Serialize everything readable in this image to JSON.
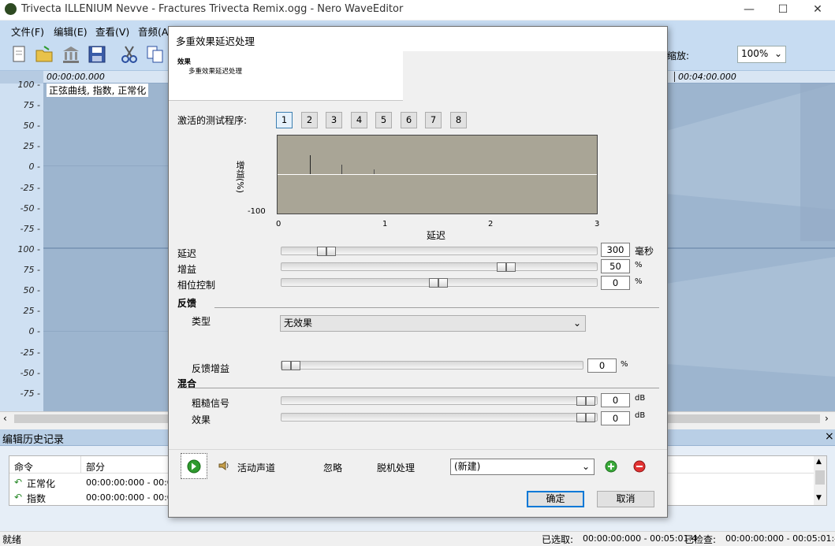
{
  "window": {
    "title": "Trivecta ILLENIUM Nevve - Fractures Trivecta Remix.ogg - Nero WaveEditor",
    "minimize_glyph": "—",
    "maximize_glyph": "☐",
    "close_glyph": "✕"
  },
  "menu": [
    "文件(F)",
    "编辑(E)",
    "查看(V)",
    "音频(A)"
  ],
  "toolbar": {
    "zoom_label": "缩放:",
    "zoom_value": "100%"
  },
  "ruler": {
    "start": "00:00:00.000",
    "mark": "00:04:00.000"
  },
  "wave": {
    "label": "正弦曲线, 指数, 正常化",
    "yticks_top": [
      "100",
      "75",
      "50",
      "25",
      "0",
      "-25",
      "-50",
      "-75"
    ],
    "yticks_bottom": [
      "100",
      "75",
      "50",
      "25",
      "0",
      "-25",
      "-50",
      "-75"
    ]
  },
  "history": {
    "title": "编辑历史记录",
    "close_glyph": "×",
    "col_command": "命令",
    "col_part": "部分",
    "rows": [
      {
        "command": "正常化",
        "part": "00:00:00:000 - 00:05"
      },
      {
        "command": "指数",
        "part": "00:00:00:000 - 00:05"
      }
    ]
  },
  "status": {
    "left": "就绪",
    "selected_label": "已选取:",
    "selected_value": "00:00:00:000 - 00:05:01:4",
    "checked_label": "已检查:",
    "checked_value": "00:00:00:000 - 00:05:01:4"
  },
  "dialog": {
    "title": "多重效果延迟处理",
    "effect_heading": "效果",
    "effect_sub": "多重效果延迟处理",
    "active_program_label": "激活的测试程序:",
    "programs": [
      "1",
      "2",
      "3",
      "4",
      "5",
      "6",
      "7",
      "8"
    ],
    "active_program": "1",
    "graph": {
      "ylabel": "增益(%)",
      "ymin_label": "-100",
      "xticks": [
        "0",
        "1",
        "2",
        "3"
      ],
      "xlabel": "延迟"
    },
    "delay_label": "延迟",
    "delay_value": "300",
    "delay_unit": "毫秒",
    "delay_level": 0.12,
    "gain_label": "增益",
    "gain_value": "50",
    "gain_unit": "%",
    "gain_level": 0.73,
    "phase_label": "相位控制",
    "phase_value": "0",
    "phase_unit": "%",
    "phase_level": 0.5,
    "feedback_heading": "反馈",
    "type_label": "类型",
    "type_value": "无效果",
    "feedback_gain_label": "反馈增益",
    "feedback_gain_value": "0",
    "feedback_gain_unit": "%",
    "feedback_gain_level": 0.0,
    "mix_heading": "混合",
    "rough_label": "粗糙信号",
    "rough_value": "0",
    "rough_unit": "dB",
    "rough_level": 1.0,
    "effect_label": "效果",
    "effect_value": "0",
    "effect_unit": "dB",
    "effect_level": 1.0,
    "active_channel_label": "活动声道",
    "ignore_label": "忽略",
    "offline_label": "脱机处理",
    "preset_value": "(新建)",
    "ok_label": "确定",
    "cancel_label": "取消"
  }
}
